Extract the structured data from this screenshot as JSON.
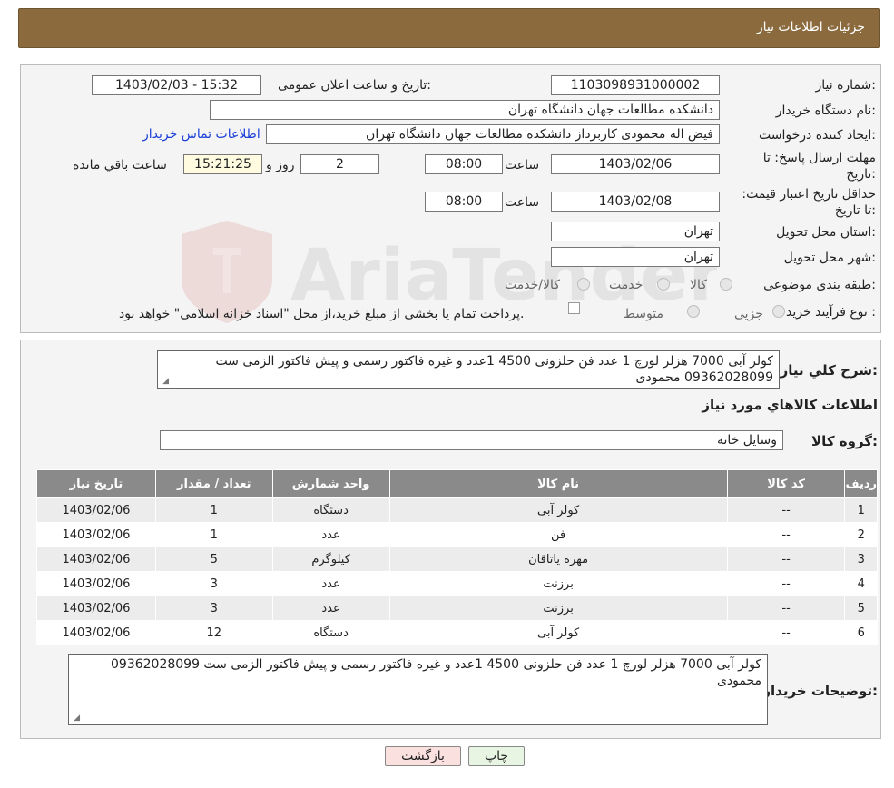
{
  "header": {
    "title": "جزئیات اطلاعات نیاز"
  },
  "form": {
    "need_number_label": "شماره نیاز:",
    "need_number": "1103098931000002",
    "announce_label": "تاریخ و ساعت اعلان عمومی:",
    "announce_value": "1403/02/03 - 15:32",
    "buyer_org_label": "نام دستگاه خریدار:",
    "buyer_org": "دانشکده مطالعات جهان دانشگاه تهران",
    "creator_label": "ایجاد کننده درخواست:",
    "creator": "فیض اله محمودی کاربرداز دانشکده مطالعات جهان دانشگاه تهران",
    "contact_link": "اطلاعات تماس خریدار",
    "deadline_label": "مهلت ارسال پاسخ: تا تاریخ:",
    "deadline_date": "1403/02/06",
    "time_label": "ساعت",
    "deadline_time": "08:00",
    "days_value": "2",
    "days_label": "روز و",
    "remaining_value": "15:21:25",
    "remaining_label": "ساعت باقي مانده",
    "validity_label": "حداقل تاریخ اعتبار قیمت: تا تاریخ:",
    "validity_date": "1403/02/08",
    "validity_time": "08:00",
    "province_label": "استان محل تحویل:",
    "province": "تهران",
    "city_label": "شهر محل تحویل:",
    "city": "تهران",
    "category_label": "طبقه بندی موضوعی:",
    "category_options": [
      "کالا",
      "خدمت",
      "کالا/خدمت"
    ],
    "process_label": "نوع فرآیند خرید :",
    "process_options": [
      "جزیی",
      "متوسط"
    ],
    "payment_note": "پرداخت تمام یا بخشی از مبلغ خرید،از محل \"اسناد خزانه اسلامی\" خواهد بود."
  },
  "details": {
    "description_label": "شرح کلي نياز:",
    "description": "کولر آبی  7000 هزلر لورچ  1 عدد فن حلزونی  4500 1عدد  و غیره  فاکتور رسمی  و پیش فاکتور الزمی ست 09362028099 محمودی",
    "goods_info_title": "اطلاعات کالاهاي مورد نياز",
    "goods_group_label": "گروه کالا:",
    "goods_group": "وسایل خانه",
    "buyer_notes_label": "توضیحات خریدار:",
    "buyer_notes": "کولر آبی  7000 هزلر لورچ  1 عدد فن حلزونی  4500 1عدد  و غیره  فاکتور رسمی  و پیش فاکتور الزمی ست 09362028099 محمودی"
  },
  "table": {
    "headers": [
      "ردیف",
      "کد کالا",
      "نام کالا",
      "واحد شمارش",
      "تعداد / مقدار",
      "تاریخ نیاز"
    ],
    "rows": [
      [
        "1",
        "--",
        "کولر آبی",
        "دستگاه",
        "1",
        "1403/02/06"
      ],
      [
        "2",
        "--",
        "فن",
        "عدد",
        "1",
        "1403/02/06"
      ],
      [
        "3",
        "--",
        "مهره یاتاقان",
        "کیلوگرم",
        "5",
        "1403/02/06"
      ],
      [
        "4",
        "--",
        "برزنت",
        "عدد",
        "3",
        "1403/02/06"
      ],
      [
        "5",
        "--",
        "برزنت",
        "عدد",
        "3",
        "1403/02/06"
      ],
      [
        "6",
        "--",
        "کولر آبی",
        "دستگاه",
        "12",
        "1403/02/06"
      ]
    ]
  },
  "buttons": {
    "print": "چاپ",
    "back": "بازگشت"
  },
  "watermark": "AriaTender.neT",
  "colors": {
    "header_bg": "#8b6a3e",
    "table_header_bg": "#8a8a8a",
    "link": "#1a3fd8"
  }
}
